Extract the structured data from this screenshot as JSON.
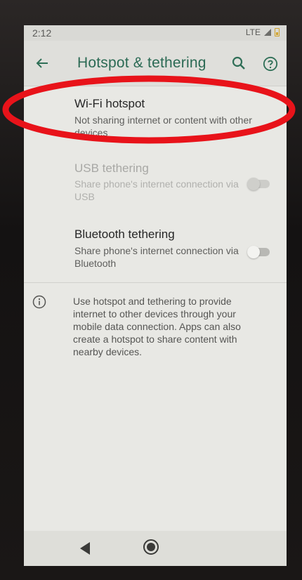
{
  "status_bar": {
    "time": "2:12",
    "network": "LTE"
  },
  "app_bar": {
    "title": "Hotspot & tethering"
  },
  "items": [
    {
      "title": "Wi-Fi hotspot",
      "summary": "Not sharing internet or content with other devices",
      "enabled": true
    },
    {
      "title": "USB tethering",
      "summary": "Share phone's internet connection via USB",
      "enabled": false,
      "switch_on": false
    },
    {
      "title": "Bluetooth tethering",
      "summary": "Share phone's internet connection via Bluetooth",
      "enabled": true,
      "switch_on": false
    }
  ],
  "info": {
    "text": "Use hotspot and tethering to provide internet to other devices through your mobile data connection. Apps can also create a hotspot to share content with nearby devices."
  },
  "icons": {
    "back": "arrow-left-icon",
    "search": "search-icon",
    "help": "help-icon",
    "info": "info-icon"
  },
  "colors": {
    "accent": "#2b6a54",
    "annotation": "#e8131a"
  }
}
